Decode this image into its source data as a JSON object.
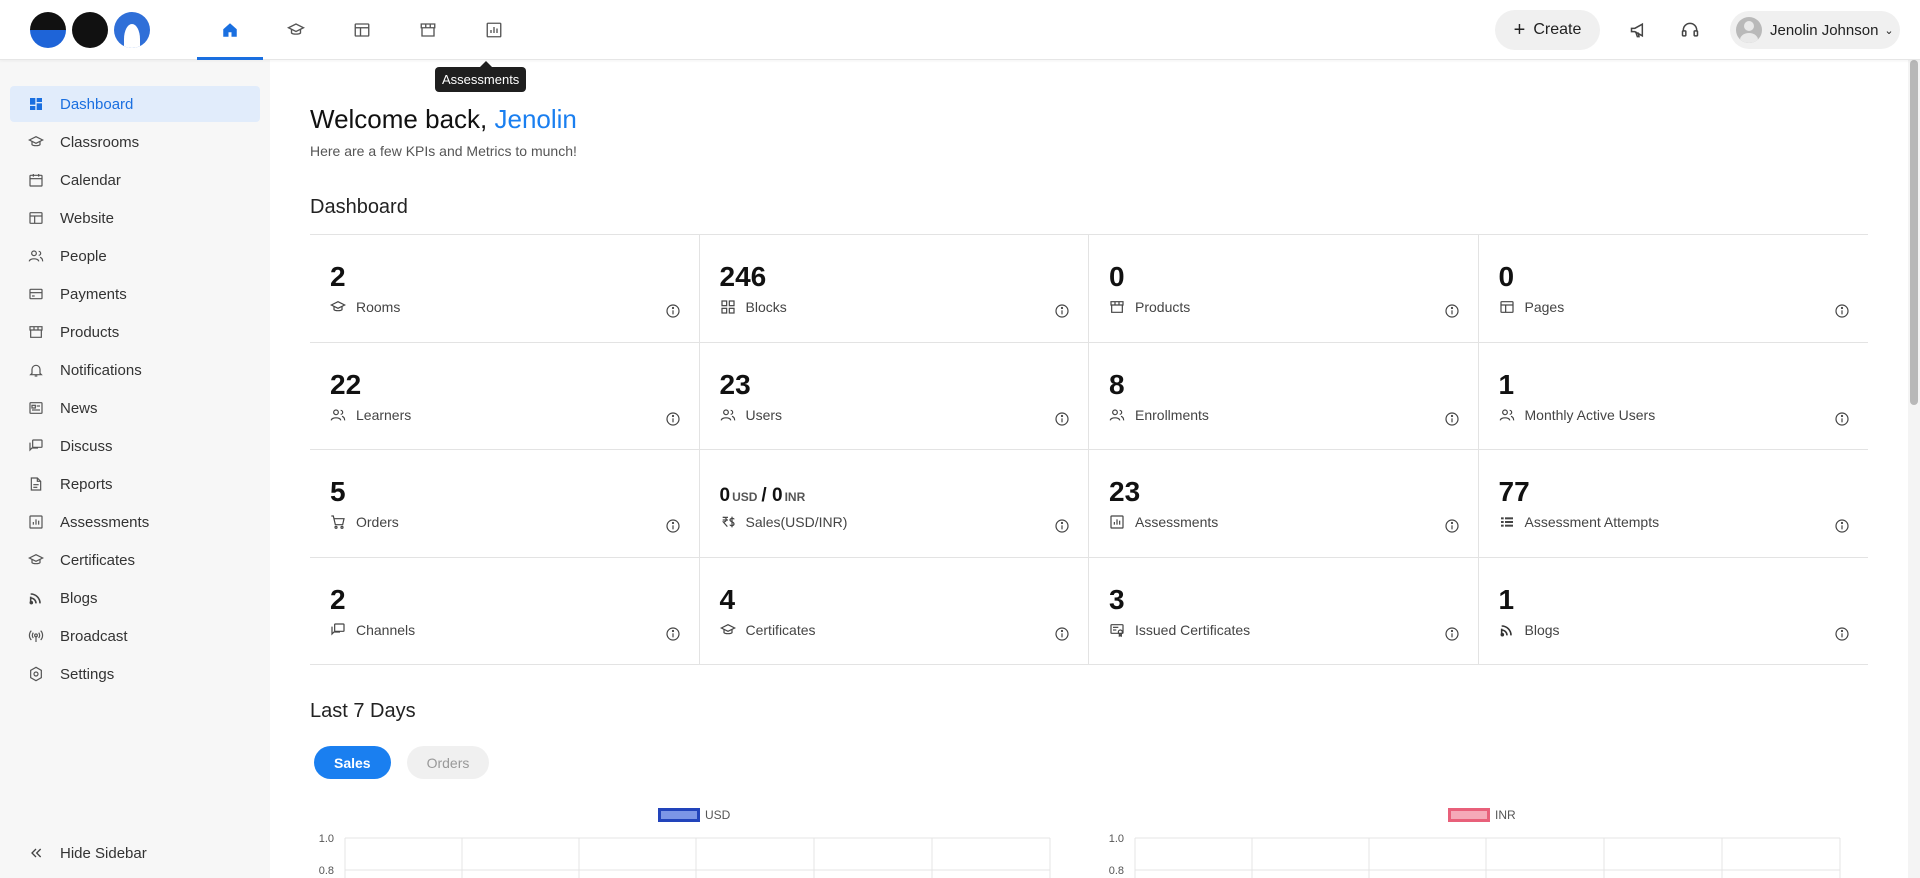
{
  "topbar": {
    "nav_icons": [
      {
        "name": "home-icon",
        "active": true
      },
      {
        "name": "classrooms-icon",
        "active": false
      },
      {
        "name": "website-icon",
        "active": false
      },
      {
        "name": "products-icon",
        "active": false
      },
      {
        "name": "assessments-icon",
        "active": false
      }
    ],
    "tooltip": "Assessments",
    "create_label": "Create",
    "user_name": "Jenolin Johnson",
    "accent_color": "#1a6fe0"
  },
  "sidebar": {
    "items": [
      {
        "label": "Dashboard",
        "icon": "dashboard-icon",
        "active": true
      },
      {
        "label": "Classrooms",
        "icon": "classrooms-icon"
      },
      {
        "label": "Calendar",
        "icon": "calendar-icon"
      },
      {
        "label": "Website",
        "icon": "website-icon"
      },
      {
        "label": "People",
        "icon": "people-icon"
      },
      {
        "label": "Payments",
        "icon": "payments-icon"
      },
      {
        "label": "Products",
        "icon": "products-icon"
      },
      {
        "label": "Notifications",
        "icon": "bell-icon"
      },
      {
        "label": "News",
        "icon": "news-icon"
      },
      {
        "label": "Discuss",
        "icon": "discuss-icon"
      },
      {
        "label": "Reports",
        "icon": "reports-icon"
      },
      {
        "label": "Assessments",
        "icon": "assessments-icon"
      },
      {
        "label": "Certificates",
        "icon": "certificates-icon"
      },
      {
        "label": "Blogs",
        "icon": "blogs-icon"
      },
      {
        "label": "Broadcast",
        "icon": "broadcast-icon"
      },
      {
        "label": "Settings",
        "icon": "settings-icon"
      }
    ],
    "hide_label": "Hide Sidebar"
  },
  "main": {
    "welcome_prefix": "Welcome back,",
    "welcome_name": "Jenolin",
    "subtitle": "Here are a few KPIs and Metrics to munch!",
    "dashboard_title": "Dashboard",
    "last7_title": "Last 7 Days",
    "kpis": [
      {
        "value": "2",
        "label": "Rooms",
        "icon": "classrooms-icon"
      },
      {
        "value": "246",
        "label": "Blocks",
        "icon": "blocks-icon"
      },
      {
        "value": "0",
        "label": "Products",
        "icon": "products-icon"
      },
      {
        "value": "0",
        "label": "Pages",
        "icon": "website-icon"
      },
      {
        "value": "22",
        "label": "Learners",
        "icon": "people-icon"
      },
      {
        "value": "23",
        "label": "Users",
        "icon": "people-icon"
      },
      {
        "value": "8",
        "label": "Enrollments",
        "icon": "people-icon"
      },
      {
        "value": "1",
        "label": "Monthly Active Users",
        "icon": "people-icon"
      },
      {
        "value": "5",
        "label": "Orders",
        "icon": "cart-icon"
      },
      {
        "value": "0",
        "value2": "0",
        "unit1": "USD",
        "unit2": "INR",
        "label": "Sales(USD/INR)",
        "icon": "sales-icon"
      },
      {
        "value": "23",
        "label": "Assessments",
        "icon": "assessments-icon"
      },
      {
        "value": "77",
        "label": "Assessment Attempts",
        "icon": "list-icon"
      },
      {
        "value": "2",
        "label": "Channels",
        "icon": "discuss-icon"
      },
      {
        "value": "4",
        "label": "Certificates",
        "icon": "certificates-icon"
      },
      {
        "value": "3",
        "label": "Issued Certificates",
        "icon": "issued-certificates-icon"
      },
      {
        "value": "1",
        "label": "Blogs",
        "icon": "blogs-icon"
      }
    ],
    "tabs": [
      {
        "label": "Sales",
        "active": true
      },
      {
        "label": "Orders",
        "active": false
      }
    ]
  },
  "chart_data": [
    {
      "type": "line",
      "legend": "USD",
      "series": [
        {
          "name": "USD",
          "values": []
        }
      ],
      "y_ticks": [
        "1.0",
        "0.8"
      ],
      "ylim": [
        0,
        1.0
      ],
      "grid": true,
      "legend_position": "top-center",
      "color": "#3355cc"
    },
    {
      "type": "line",
      "legend": "INR",
      "series": [
        {
          "name": "INR",
          "values": []
        }
      ],
      "y_ticks": [
        "1.0",
        "0.8"
      ],
      "ylim": [
        0,
        1.0
      ],
      "grid": true,
      "legend_position": "top-center",
      "color": "#e8607a"
    }
  ]
}
